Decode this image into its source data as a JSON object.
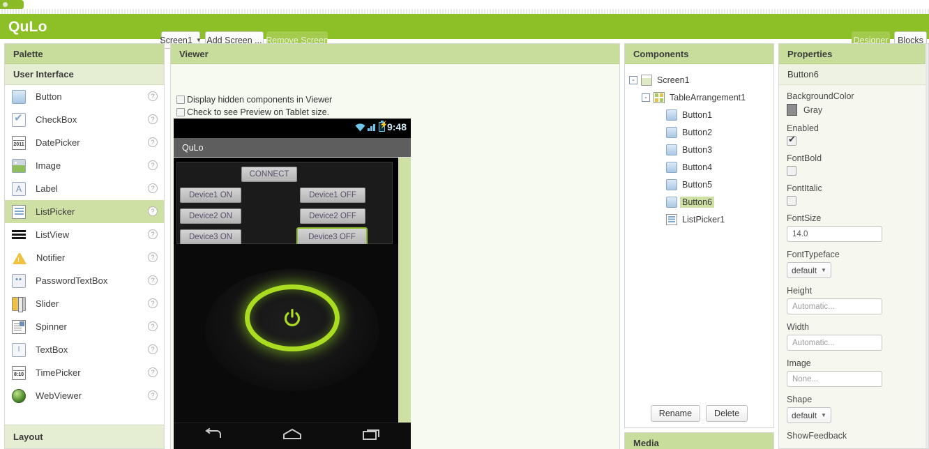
{
  "topbar": {
    "brand": "QuLo",
    "screen_select": "Screen1",
    "add_screen": "Add Screen ...",
    "remove_screen": "Remove Screen",
    "designer": "Designer",
    "blocks": "Blocks"
  },
  "palette": {
    "header": "Palette",
    "section": "User Interface",
    "footer_section": "Layout",
    "help_glyph": "?",
    "items": [
      {
        "label": "Button",
        "icon": "button-icon"
      },
      {
        "label": "CheckBox",
        "icon": "checkbox-icon"
      },
      {
        "label": "DatePicker",
        "icon": "datepicker-icon",
        "glyph": "2011"
      },
      {
        "label": "Image",
        "icon": "image-icon"
      },
      {
        "label": "Label",
        "icon": "label-icon",
        "glyph": "A"
      },
      {
        "label": "ListPicker",
        "icon": "listpicker-icon",
        "selected": true
      },
      {
        "label": "ListView",
        "icon": "listview-icon"
      },
      {
        "label": "Notifier",
        "icon": "notifier-icon"
      },
      {
        "label": "PasswordTextBox",
        "icon": "passwordtextbox-icon",
        "glyph": "••"
      },
      {
        "label": "Slider",
        "icon": "slider-icon"
      },
      {
        "label": "Spinner",
        "icon": "spinner-icon"
      },
      {
        "label": "TextBox",
        "icon": "textbox-icon",
        "glyph": "I"
      },
      {
        "label": "TimePicker",
        "icon": "timepicker-icon",
        "glyph": "8:10"
      },
      {
        "label": "WebViewer",
        "icon": "webviewer-icon"
      }
    ]
  },
  "viewer": {
    "header": "Viewer",
    "check_hidden": "Display hidden components in Viewer",
    "check_tablet": "Check to see Preview on Tablet size.",
    "phone": {
      "clock": "9:48",
      "title": "QuLo",
      "buttons": [
        {
          "label": "CONNECT",
          "selected": false
        },
        {
          "label": "Device1 ON",
          "selected": false
        },
        {
          "label": "Device1 OFF",
          "selected": false
        },
        {
          "label": "Device2 ON",
          "selected": false
        },
        {
          "label": "Device2 OFF",
          "selected": false
        },
        {
          "label": "Device3 ON",
          "selected": false
        },
        {
          "label": "Device3 OFF",
          "selected": true
        }
      ],
      "accent_color": "#aadd22"
    }
  },
  "components": {
    "header": "Components",
    "tree": [
      {
        "label": "Screen1",
        "icon": "screen-icon",
        "depth": 0,
        "expander": "-"
      },
      {
        "label": "TableArrangement1",
        "icon": "table-icon",
        "depth": 1,
        "expander": "-"
      },
      {
        "label": "Button1",
        "icon": "button-icon",
        "depth": 2
      },
      {
        "label": "Button2",
        "icon": "button-icon",
        "depth": 2
      },
      {
        "label": "Button3",
        "icon": "button-icon",
        "depth": 2
      },
      {
        "label": "Button4",
        "icon": "button-icon",
        "depth": 2
      },
      {
        "label": "Button5",
        "icon": "button-icon",
        "depth": 2
      },
      {
        "label": "Button6",
        "icon": "button-icon",
        "depth": 2,
        "selected": true
      },
      {
        "label": "ListPicker1",
        "icon": "listpicker-icon",
        "depth": 2
      }
    ],
    "rename": "Rename",
    "delete": "Delete"
  },
  "media": {
    "header": "Media"
  },
  "properties": {
    "header": "Properties",
    "target": "Button6",
    "rows": [
      {
        "name": "BackgroundColor",
        "type": "color",
        "value": "Gray",
        "swatch": "#8d8d8d"
      },
      {
        "name": "Enabled",
        "type": "checkbox",
        "checked": true
      },
      {
        "name": "FontBold",
        "type": "checkbox",
        "checked": false
      },
      {
        "name": "FontItalic",
        "type": "checkbox",
        "checked": false
      },
      {
        "name": "FontSize",
        "type": "input",
        "value": "14.0"
      },
      {
        "name": "FontTypeface",
        "type": "select",
        "value": "default"
      },
      {
        "name": "Height",
        "type": "input",
        "value": "Automatic...",
        "muted": true
      },
      {
        "name": "Width",
        "type": "input",
        "value": "Automatic...",
        "muted": true
      },
      {
        "name": "Image",
        "type": "input",
        "value": "None...",
        "muted": true
      },
      {
        "name": "Shape",
        "type": "select",
        "value": "default"
      },
      {
        "name": "ShowFeedback",
        "type": "label"
      }
    ]
  }
}
